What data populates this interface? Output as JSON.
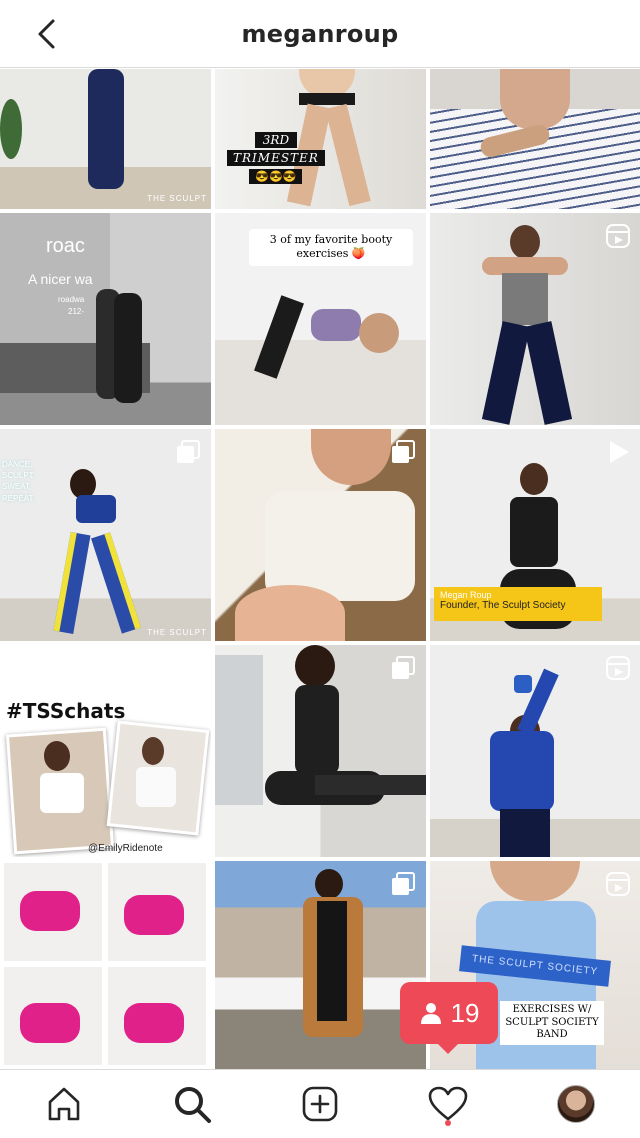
{
  "header": {
    "title": "meganroup"
  },
  "tiles": {
    "t1": {
      "caption": "THE SCULPT"
    },
    "t2": {
      "line1": "3RD",
      "line2": "TRIMESTER",
      "emoji": "😎😎😎"
    },
    "t4": {
      "brand": "roac",
      "slogan": "A nicer wa",
      "url": "roadwa",
      "phone": "212-"
    },
    "t5": {
      "caption": "3 of my favorite booty exercises 🍑"
    },
    "t7": {
      "neon": "DANCE, SCULPT, SWEAT, REPEAT.",
      "caption": "THE SCULPT"
    },
    "t9": {
      "name": "Megan Roup",
      "role": "Founder, The Sculpt Society"
    },
    "t10": {
      "hashtag": "#TSSchats",
      "handle": "@EmilyRidenote"
    },
    "t15": {
      "band": "THE SCULPT SOCIETY",
      "caption": "EXERCISES W/ SCULPT SOCIETY BAND"
    }
  },
  "notification": {
    "count": "19",
    "icon": "person-icon"
  },
  "tabbar": {
    "items": [
      "home-icon",
      "search-icon",
      "add-post-icon",
      "heart-icon",
      "profile-avatar"
    ]
  },
  "colors": {
    "notification": "#ed4956",
    "caption_yellow": "#f5c518",
    "text": "#262626"
  }
}
